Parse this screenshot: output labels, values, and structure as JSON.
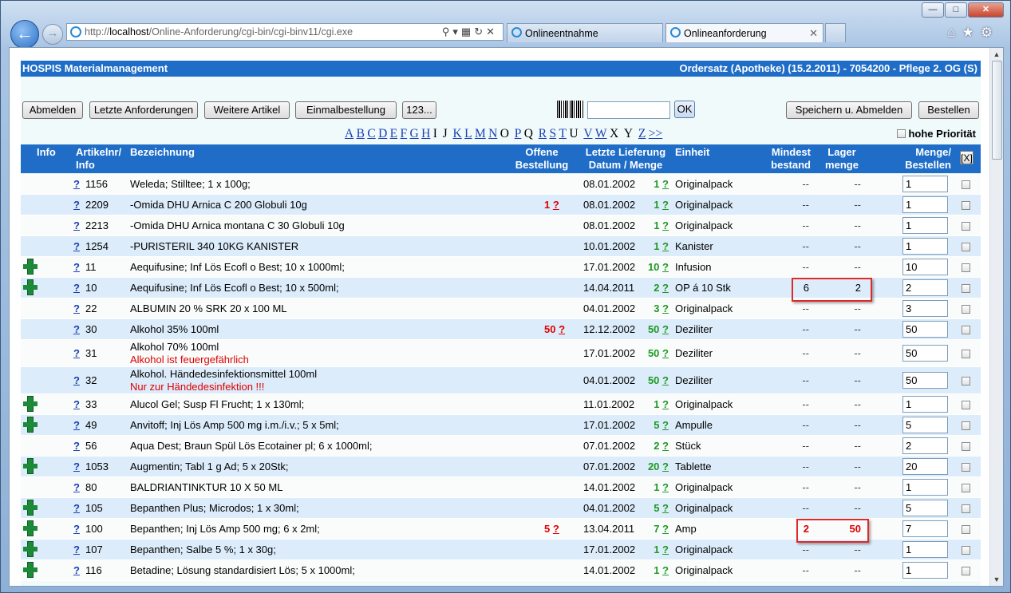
{
  "browser": {
    "url_host": "localhost",
    "url_prefix": "http://",
    "url_path": "/Online-Anforderung/cgi-bin/cgi-binv11/cgi.exe",
    "tabs": [
      {
        "label": "Onlineentnahme",
        "active": false
      },
      {
        "label": "Onlineanforderung",
        "active": true
      }
    ]
  },
  "page": {
    "app_title": "HOSPIS Materialmanagement",
    "context_title": "Ordersatz (Apotheke) (15.2.2011) - 7054200 - Pflege 2. OG (S)",
    "buttons": {
      "logout": "Abmelden",
      "last_requests": "Letzte Anforderungen",
      "more_items": "Weitere Artikel",
      "single_order": "Einmalbestellung",
      "numbers": "123...",
      "ok": "OK",
      "save_logout": "Speichern u. Abmelden",
      "order": "Bestellen"
    },
    "alphabet": [
      {
        "l": "A",
        "link": true
      },
      {
        "l": "B",
        "link": true
      },
      {
        "l": "C",
        "link": true
      },
      {
        "l": "D",
        "link": true
      },
      {
        "l": "E",
        "link": true
      },
      {
        "l": "F",
        "link": true
      },
      {
        "l": "G",
        "link": true
      },
      {
        "l": "H",
        "link": true
      },
      {
        "l": "I",
        "link": false
      },
      {
        "l": "J",
        "link": false
      },
      {
        "l": "K",
        "link": true
      },
      {
        "l": "L",
        "link": true
      },
      {
        "l": "M",
        "link": true
      },
      {
        "l": "N",
        "link": true
      },
      {
        "l": "O",
        "link": false
      },
      {
        "l": "P",
        "link": true
      },
      {
        "l": "Q",
        "link": false
      },
      {
        "l": "R",
        "link": true
      },
      {
        "l": "S",
        "link": true
      },
      {
        "l": "T",
        "link": true
      },
      {
        "l": "U",
        "link": false
      },
      {
        "l": "V",
        "link": true
      },
      {
        "l": "W",
        "link": true
      },
      {
        "l": "X",
        "link": false
      },
      {
        "l": "Y",
        "link": false
      },
      {
        "l": "Z",
        "link": true
      },
      {
        "l": ">>",
        "link": true
      }
    ],
    "priority_label": "hohe Priorität",
    "headers": {
      "info": "Info",
      "artnr_1": "Artikelnr/",
      "artnr_2": "Info",
      "desc": "Bezeichnung",
      "open_1": "Offene",
      "open_2": "Bestellung",
      "last_1": "Letzte Lieferung",
      "last_2": "Datum / Menge",
      "unit": "Einheit",
      "min_1": "Mindest",
      "min_2": "bestand",
      "stock_1": "Lager",
      "stock_2": "menge",
      "qty_1": "Menge/",
      "qty_2": "Bestellen",
      "clear": "[X]"
    },
    "rows": [
      {
        "plus": false,
        "nr": "1156",
        "desc": "Weleda; Stilltee; 1 x 100g;",
        "warn": "",
        "open": "",
        "date": "08.01.2002",
        "lq": "1",
        "unit": "Originalpack",
        "min": "--",
        "stock": "--",
        "qty": "1"
      },
      {
        "plus": false,
        "nr": "2209",
        "desc": "-Omida DHU Arnica C 200 Globuli 10g",
        "warn": "",
        "open": "1",
        "date": "08.01.2002",
        "lq": "1",
        "unit": "Originalpack",
        "min": "--",
        "stock": "--",
        "qty": "1"
      },
      {
        "plus": false,
        "nr": "2213",
        "desc": "-Omida DHU Arnica montana C 30 Globuli 10g",
        "warn": "",
        "open": "",
        "date": "08.01.2002",
        "lq": "1",
        "unit": "Originalpack",
        "min": "--",
        "stock": "--",
        "qty": "1"
      },
      {
        "plus": false,
        "nr": "1254",
        "desc": "-PURISTERIL 340 10KG KANISTER",
        "warn": "",
        "open": "",
        "date": "10.01.2002",
        "lq": "1",
        "unit": "Kanister",
        "min": "--",
        "stock": "--",
        "qty": "1"
      },
      {
        "plus": true,
        "nr": "11",
        "desc": "Aequifusine; Inf Lös Ecofl o Best; 10 x 1000ml;",
        "warn": "",
        "open": "",
        "date": "17.01.2002",
        "lq": "10",
        "unit": "Infusion",
        "min": "--",
        "stock": "--",
        "qty": "10"
      },
      {
        "plus": true,
        "nr": "10",
        "desc": "Aequifusine; Inf Lös Ecofl o Best; 10 x 500ml;",
        "warn": "",
        "open": "",
        "date": "14.04.2011",
        "lq": "2",
        "unit": "OP á 10 Stk",
        "min": "6",
        "stock": "2",
        "qty": "2"
      },
      {
        "plus": false,
        "nr": "22",
        "desc": "ALBUMIN 20 % SRK 20 x 100 ML",
        "warn": "",
        "open": "",
        "date": "04.01.2002",
        "lq": "3",
        "unit": "Originalpack",
        "min": "--",
        "stock": "--",
        "qty": "3"
      },
      {
        "plus": false,
        "nr": "30",
        "desc": "Alkohol 35% 100ml",
        "warn": "",
        "open": "50",
        "date": "12.12.2002",
        "lq": "50",
        "unit": "Deziliter",
        "min": "--",
        "stock": "--",
        "qty": "50"
      },
      {
        "plus": false,
        "nr": "31",
        "desc": "Alkohol 70% 100ml",
        "warn": "Alkohol ist feuergefährlich",
        "open": "",
        "date": "17.01.2002",
        "lq": "50",
        "unit": "Deziliter",
        "min": "--",
        "stock": "--",
        "qty": "50"
      },
      {
        "plus": false,
        "nr": "32",
        "desc": "Alkohol. Händedesinfektionsmittel 100ml",
        "warn": "Nur zur Händedesinfektion !!!",
        "open": "",
        "date": "04.01.2002",
        "lq": "50",
        "unit": "Deziliter",
        "min": "--",
        "stock": "--",
        "qty": "50"
      },
      {
        "plus": true,
        "nr": "33",
        "desc": "Alucol Gel; Susp Fl Frucht; 1 x 130ml;",
        "warn": "",
        "open": "",
        "date": "11.01.2002",
        "lq": "1",
        "unit": "Originalpack",
        "min": "--",
        "stock": "--",
        "qty": "1"
      },
      {
        "plus": true,
        "nr": "49",
        "desc": "Anvitoff; Inj Lös Amp 500 mg i.m./i.v.; 5 x 5ml;",
        "warn": "",
        "open": "",
        "date": "17.01.2002",
        "lq": "5",
        "unit": "Ampulle",
        "min": "--",
        "stock": "--",
        "qty": "5"
      },
      {
        "plus": false,
        "nr": "56",
        "desc": "Aqua Dest; Braun Spül Lös Ecotainer pl; 6 x 1000ml;",
        "warn": "",
        "open": "",
        "date": "07.01.2002",
        "lq": "2",
        "unit": "Stück",
        "min": "--",
        "stock": "--",
        "qty": "2"
      },
      {
        "plus": true,
        "nr": "1053",
        "desc": "Augmentin; Tabl 1 g Ad; 5 x 20Stk;",
        "warn": "",
        "open": "",
        "date": "07.01.2002",
        "lq": "20",
        "unit": "Tablette",
        "min": "--",
        "stock": "--",
        "qty": "20"
      },
      {
        "plus": false,
        "nr": "80",
        "desc": "BALDRIANTINKTUR 10 X 50 ML",
        "warn": "",
        "open": "",
        "date": "14.01.2002",
        "lq": "1",
        "unit": "Originalpack",
        "min": "--",
        "stock": "--",
        "qty": "1"
      },
      {
        "plus": true,
        "nr": "105",
        "desc": "Bepanthen Plus; Microdos; 1 x 30ml;",
        "warn": "",
        "open": "",
        "date": "04.01.2002",
        "lq": "5",
        "unit": "Originalpack",
        "min": "--",
        "stock": "--",
        "qty": "5"
      },
      {
        "plus": true,
        "nr": "100",
        "desc": "Bepanthen; Inj Lös Amp 500 mg; 6 x 2ml;",
        "warn": "",
        "open": "5",
        "date": "13.04.2011",
        "lq": "7",
        "unit": "Amp",
        "min": "2",
        "stock": "50",
        "qty": "7",
        "redstock": true
      },
      {
        "plus": true,
        "nr": "107",
        "desc": "Bepanthen; Salbe 5 %; 1 x 30g;",
        "warn": "",
        "open": "",
        "date": "17.01.2002",
        "lq": "1",
        "unit": "Originalpack",
        "min": "--",
        "stock": "--",
        "qty": "1"
      },
      {
        "plus": true,
        "nr": "116",
        "desc": "Betadine; Lösung standardisiert Lös; 5 x 1000ml;",
        "warn": "",
        "open": "",
        "date": "14.01.2002",
        "lq": "1",
        "unit": "Originalpack",
        "min": "--",
        "stock": "--",
        "qty": "1"
      }
    ]
  }
}
